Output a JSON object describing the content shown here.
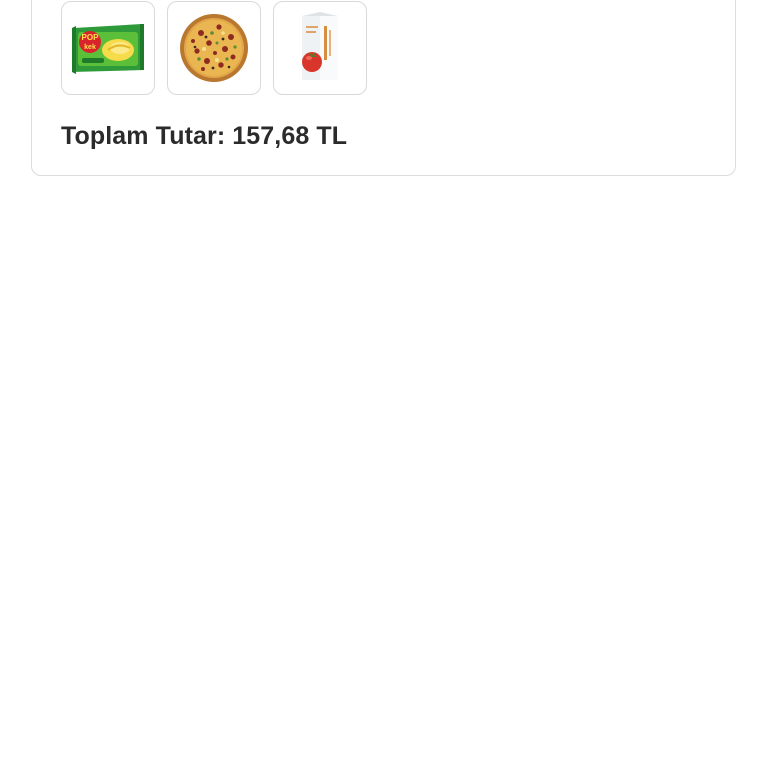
{
  "order": {
    "products": [
      {
        "name": "Popkek snack cake",
        "icon": "snack-cake-image",
        "logo_text": "POP kek"
      },
      {
        "name": "Pizza",
        "icon": "pizza-image"
      },
      {
        "name": "Tomato juice carton",
        "icon": "juice-carton-image"
      }
    ],
    "total_label": "Toplam Tutar: 157,68 TL"
  },
  "colors": {
    "card_border": "#dcdcdc",
    "text": "#2b2b2b",
    "snack_green": "#2f9a3a",
    "snack_red": "#d8232a",
    "pizza_crust": "#c98a3c",
    "tomato_red": "#d9362b"
  }
}
